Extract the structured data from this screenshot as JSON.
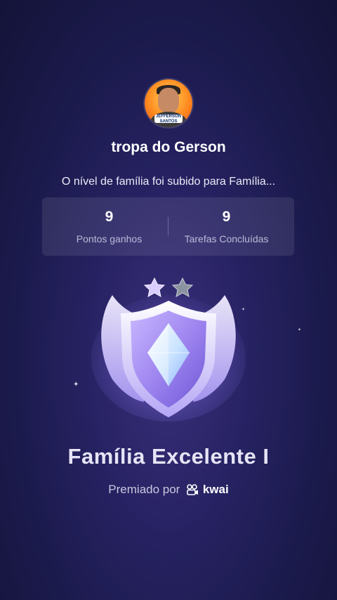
{
  "profile": {
    "avatar_badge_line1": "JEFFERSON",
    "avatar_badge_line2": "SANTOS",
    "name": "tropa do Gerson"
  },
  "message": "O nível de família foi subido para Família...",
  "stats": [
    {
      "value": "9",
      "label": "Pontos ganhos"
    },
    {
      "value": "9",
      "label": "Tarefas Concluídas"
    }
  ],
  "badge": {
    "stars_filled": 1,
    "stars_total": 2,
    "icon": "shield-diamond-icon"
  },
  "title": "Família Excelente I",
  "awarded_by": {
    "prefix": "Premiado por",
    "brand": "kwai",
    "brand_icon": "kwai-logo-icon"
  },
  "colors": {
    "background": "#262262",
    "badge_main": "#c7b8ff",
    "text_secondary": "#bdb9d8"
  }
}
